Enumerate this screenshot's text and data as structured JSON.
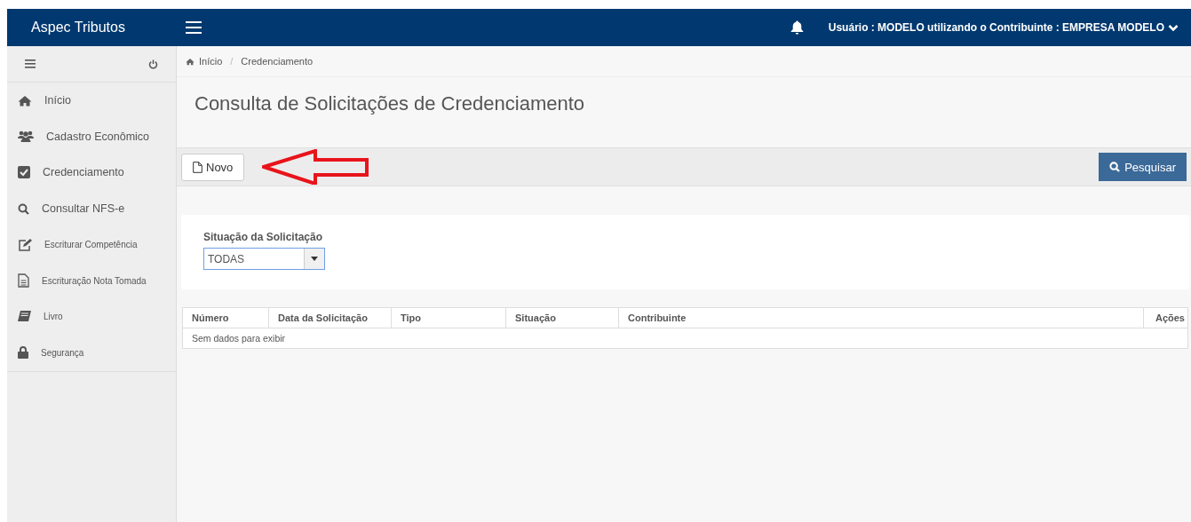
{
  "navbar": {
    "brand": "Aspec Tributos",
    "user_text": "Usuário : MODELO utilizando o Contribuinte : EMPRESA MODELO"
  },
  "sidebar": {
    "items": [
      {
        "label": "Início",
        "kind": "home"
      },
      {
        "label": "Cadastro Econômico",
        "kind": "users"
      },
      {
        "label": "Credenciamento",
        "kind": "check"
      },
      {
        "label": "Consultar NFS-e",
        "kind": "search"
      },
      {
        "label": "Escriturar Competência",
        "kind": "edit"
      },
      {
        "label": "Escrituração Nota Tomada",
        "kind": "file"
      },
      {
        "label": "Livro",
        "kind": "book"
      },
      {
        "label": "Segurança",
        "kind": "lock"
      }
    ]
  },
  "breadcrumb": [
    "Início",
    "Credenciamento"
  ],
  "breadcrumb_separator": "/",
  "page_title": "Consulta de Solicitações de Credenciamento",
  "toolbar": {
    "new_button": "Novo",
    "search_button": "Pesquisar"
  },
  "filter": {
    "label": "Situação da Solicitação",
    "value": "TODAS"
  },
  "table": {
    "columns": [
      "Número",
      "Data da Solicitação",
      "Tipo",
      "Situação",
      "Contribuinte",
      "Ações"
    ],
    "empty_text": "Sem dados para exibir"
  }
}
